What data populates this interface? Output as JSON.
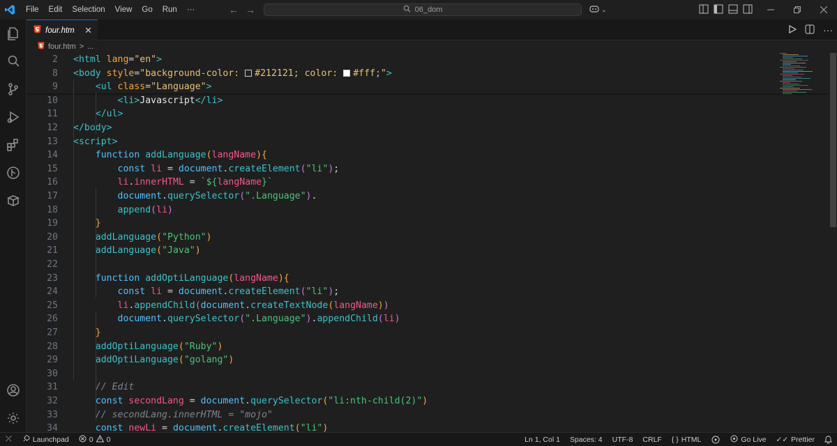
{
  "menu": [
    "File",
    "Edit",
    "Selection",
    "View",
    "Go",
    "Run",
    "···"
  ],
  "search": {
    "text": "06_dom"
  },
  "tab": {
    "name": "four.htm",
    "close": "✕"
  },
  "breadcrumb": {
    "file": "four.htm",
    "sep": ">",
    "rest": "..."
  },
  "colors": {
    "accent": "#0078d4",
    "editor_bg": "#1f1f1f",
    "html_icon": "#e44d26"
  },
  "code_lines": [
    {
      "n": "2",
      "tokens": [
        [
          "t-tag",
          "<html "
        ],
        [
          "t-attr",
          "lang"
        ],
        [
          "t-punc",
          "="
        ],
        [
          "t-str",
          "\"en\""
        ],
        [
          "t-tag",
          ">"
        ]
      ]
    },
    {
      "n": "8",
      "tokens": [
        [
          "t-tag",
          "<body "
        ],
        [
          "t-attr",
          "style"
        ],
        [
          "t-punc",
          "="
        ],
        [
          "t-str",
          "\"background-color: "
        ],
        [
          "swatch-dark",
          ""
        ],
        [
          "t-str",
          "#212121; color: "
        ],
        [
          "swatch-light",
          ""
        ],
        [
          "t-str",
          "#fff;\""
        ],
        [
          "t-tag",
          ">"
        ]
      ]
    },
    {
      "n": "9",
      "tokens": [
        [
          "t-txt",
          "    "
        ],
        [
          "t-tag",
          "<ul "
        ],
        [
          "t-attr",
          "class"
        ],
        [
          "t-punc",
          "="
        ],
        [
          "t-str",
          "\"Language\""
        ],
        [
          "t-tag",
          ">"
        ]
      ]
    },
    {
      "n": "10",
      "tokens": [
        [
          "t-txt",
          "        "
        ],
        [
          "t-tag",
          "<li>"
        ],
        [
          "t-txt",
          "Javascript"
        ],
        [
          "t-tag",
          "</li>"
        ]
      ]
    },
    {
      "n": "11",
      "tokens": [
        [
          "t-txt",
          "    "
        ],
        [
          "t-tag",
          "</ul>"
        ]
      ]
    },
    {
      "n": "12",
      "tokens": [
        [
          "t-tag",
          "</body>"
        ]
      ]
    },
    {
      "n": "13",
      "tokens": [
        [
          "t-tag",
          "<script>"
        ]
      ]
    },
    {
      "n": "14",
      "tokens": [
        [
          "t-txt",
          "    "
        ],
        [
          "t-kw",
          "function "
        ],
        [
          "t-fn",
          "addLanguage"
        ],
        [
          "t-paren",
          "("
        ],
        [
          "t-var",
          "langName"
        ],
        [
          "t-paren",
          ")"
        ],
        [
          "t-paren",
          "{"
        ]
      ]
    },
    {
      "n": "15",
      "tokens": [
        [
          "t-txt",
          "        "
        ],
        [
          "t-kw",
          "const "
        ],
        [
          "t-var",
          "li"
        ],
        [
          "t-punc",
          " = "
        ],
        [
          "t-kw",
          "document"
        ],
        [
          "t-punc",
          "."
        ],
        [
          "t-fn",
          "createElement"
        ],
        [
          "t-paren2",
          "("
        ],
        [
          "t-str2",
          "\"li\""
        ],
        [
          "t-paren2",
          ")"
        ],
        [
          "t-punc",
          ";"
        ]
      ]
    },
    {
      "n": "16",
      "tokens": [
        [
          "t-txt",
          "        "
        ],
        [
          "t-var",
          "li"
        ],
        [
          "t-punc",
          "."
        ],
        [
          "t-prop",
          "innerHTML"
        ],
        [
          "t-punc",
          " = "
        ],
        [
          "t-str2",
          "`${"
        ],
        [
          "t-var",
          "langName"
        ],
        [
          "t-str2",
          "}`"
        ]
      ]
    },
    {
      "n": "17",
      "tokens": [
        [
          "t-txt",
          "        "
        ],
        [
          "t-kw",
          "document"
        ],
        [
          "t-punc",
          "."
        ],
        [
          "t-fn",
          "querySelector"
        ],
        [
          "t-paren2",
          "("
        ],
        [
          "t-str2",
          "\".Language\""
        ],
        [
          "t-paren2",
          ")"
        ],
        [
          "t-punc",
          "."
        ]
      ]
    },
    {
      "n": "18",
      "tokens": [
        [
          "t-txt",
          "        "
        ],
        [
          "t-fn",
          "append"
        ],
        [
          "t-paren2",
          "("
        ],
        [
          "t-var",
          "li"
        ],
        [
          "t-paren2",
          ")"
        ]
      ]
    },
    {
      "n": "19",
      "tokens": [
        [
          "t-txt",
          "    "
        ],
        [
          "t-paren",
          "}"
        ]
      ]
    },
    {
      "n": "20",
      "tokens": [
        [
          "t-txt",
          "    "
        ],
        [
          "t-fn",
          "addLanguage"
        ],
        [
          "t-paren",
          "("
        ],
        [
          "t-str2",
          "\"Python\""
        ],
        [
          "t-paren",
          ")"
        ]
      ]
    },
    {
      "n": "21",
      "tokens": [
        [
          "t-txt",
          "    "
        ],
        [
          "t-fn",
          "addLanguage"
        ],
        [
          "t-paren",
          "("
        ],
        [
          "t-str2",
          "\"Java\""
        ],
        [
          "t-paren",
          ")"
        ]
      ]
    },
    {
      "n": "22",
      "tokens": []
    },
    {
      "n": "23",
      "tokens": [
        [
          "t-txt",
          "    "
        ],
        [
          "t-kw",
          "function "
        ],
        [
          "t-fn",
          "addOptiLanguage"
        ],
        [
          "t-paren",
          "("
        ],
        [
          "t-var",
          "langName"
        ],
        [
          "t-paren",
          ")"
        ],
        [
          "t-paren",
          "{"
        ]
      ]
    },
    {
      "n": "24",
      "tokens": [
        [
          "t-txt",
          "        "
        ],
        [
          "t-kw",
          "const "
        ],
        [
          "t-var",
          "li"
        ],
        [
          "t-punc",
          " = "
        ],
        [
          "t-kw",
          "document"
        ],
        [
          "t-punc",
          "."
        ],
        [
          "t-fn",
          "createElement"
        ],
        [
          "t-paren2",
          "("
        ],
        [
          "t-str2",
          "\"li\""
        ],
        [
          "t-paren2",
          ")"
        ],
        [
          "t-punc",
          ";"
        ]
      ]
    },
    {
      "n": "25",
      "tokens": [
        [
          "t-txt",
          "        "
        ],
        [
          "t-var",
          "li"
        ],
        [
          "t-punc",
          "."
        ],
        [
          "t-fn",
          "appendChild"
        ],
        [
          "t-paren2",
          "("
        ],
        [
          "t-kw",
          "document"
        ],
        [
          "t-punc",
          "."
        ],
        [
          "t-fn",
          "createTextNode"
        ],
        [
          "t-paren",
          "("
        ],
        [
          "t-var",
          "langName"
        ],
        [
          "t-paren",
          ")"
        ],
        [
          "t-paren2",
          ")"
        ]
      ]
    },
    {
      "n": "26",
      "tokens": [
        [
          "t-txt",
          "        "
        ],
        [
          "t-kw",
          "document"
        ],
        [
          "t-punc",
          "."
        ],
        [
          "t-fn",
          "querySelector"
        ],
        [
          "t-paren2",
          "("
        ],
        [
          "t-str2",
          "\".Language\""
        ],
        [
          "t-paren2",
          ")"
        ],
        [
          "t-punc",
          "."
        ],
        [
          "t-fn",
          "appendChild"
        ],
        [
          "t-paren2",
          "("
        ],
        [
          "t-var",
          "li"
        ],
        [
          "t-paren2",
          ")"
        ]
      ]
    },
    {
      "n": "27",
      "tokens": [
        [
          "t-txt",
          "    "
        ],
        [
          "t-paren",
          "}"
        ]
      ]
    },
    {
      "n": "28",
      "tokens": [
        [
          "t-txt",
          "    "
        ],
        [
          "t-fn",
          "addOptiLanguage"
        ],
        [
          "t-paren",
          "("
        ],
        [
          "t-str2",
          "\"Ruby\""
        ],
        [
          "t-paren",
          ")"
        ]
      ]
    },
    {
      "n": "29",
      "tokens": [
        [
          "t-txt",
          "    "
        ],
        [
          "t-fn",
          "addOptiLanguage"
        ],
        [
          "t-paren",
          "("
        ],
        [
          "t-str2",
          "\"golang\""
        ],
        [
          "t-paren",
          ")"
        ]
      ]
    },
    {
      "n": "30",
      "tokens": []
    },
    {
      "n": "31",
      "tokens": [
        [
          "t-txt",
          "    "
        ],
        [
          "t-com",
          "// Edit"
        ]
      ]
    },
    {
      "n": "32",
      "tokens": [
        [
          "t-txt",
          "    "
        ],
        [
          "t-kw",
          "const "
        ],
        [
          "t-var",
          "secondLang"
        ],
        [
          "t-punc",
          " = "
        ],
        [
          "t-kw",
          "document"
        ],
        [
          "t-punc",
          "."
        ],
        [
          "t-fn",
          "querySelector"
        ],
        [
          "t-paren",
          "("
        ],
        [
          "t-str2",
          "\"li:nth-child(2)\""
        ],
        [
          "t-paren",
          ")"
        ]
      ]
    },
    {
      "n": "33",
      "tokens": [
        [
          "t-txt",
          "    "
        ],
        [
          "t-com",
          "// secondLang.innerHTML = \"mojo\""
        ]
      ]
    },
    {
      "n": "34",
      "tokens": [
        [
          "t-txt",
          "    "
        ],
        [
          "t-kw",
          "const "
        ],
        [
          "t-var",
          "newLi"
        ],
        [
          "t-punc",
          " = "
        ],
        [
          "t-kw",
          "document"
        ],
        [
          "t-punc",
          "."
        ],
        [
          "t-fn",
          "createElement"
        ],
        [
          "t-paren",
          "("
        ],
        [
          "t-str2",
          "\"li\""
        ],
        [
          "t-paren",
          ")"
        ]
      ]
    }
  ],
  "status": {
    "launchpad": "Launchpad",
    "errors": "0",
    "warnings": "0",
    "position": "Ln 1, Col 1",
    "spaces": "Spaces: 4",
    "encoding": "UTF-8",
    "eol": "CRLF",
    "language": "HTML",
    "golive": "Go Live",
    "prettier": "Prettier"
  }
}
